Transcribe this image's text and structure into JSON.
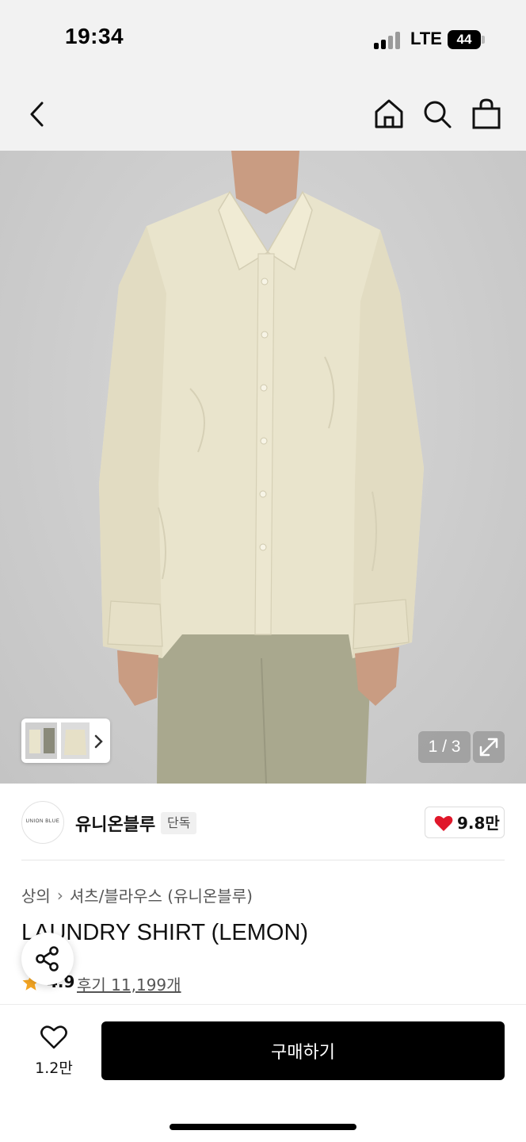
{
  "status_bar": {
    "time": "19:34",
    "network": "LTE",
    "battery": "44"
  },
  "nav": {
    "icons": [
      "back-icon",
      "home-icon",
      "search-icon",
      "shopping-bag-icon"
    ]
  },
  "gallery": {
    "counter": "1 / 3",
    "current": 1,
    "total": 3
  },
  "brand": {
    "logo_text": "UNION BLUE",
    "name": "유니온블루",
    "badge": "단독",
    "likes": "9.8만"
  },
  "breadcrumb": {
    "category": "상의",
    "sub_category": "셔츠/블라우스 (유니온블루)"
  },
  "product": {
    "title": "LAUNDRY SHIRT (LEMON)",
    "rating": "4.9",
    "reviews": "후기 11,199개"
  },
  "bottom_bar": {
    "wish_count": "1.2만",
    "buy_label": "구매하기"
  },
  "colors": {
    "accent": "#000000",
    "heart": "#e0172a",
    "star": "#f5a623"
  }
}
